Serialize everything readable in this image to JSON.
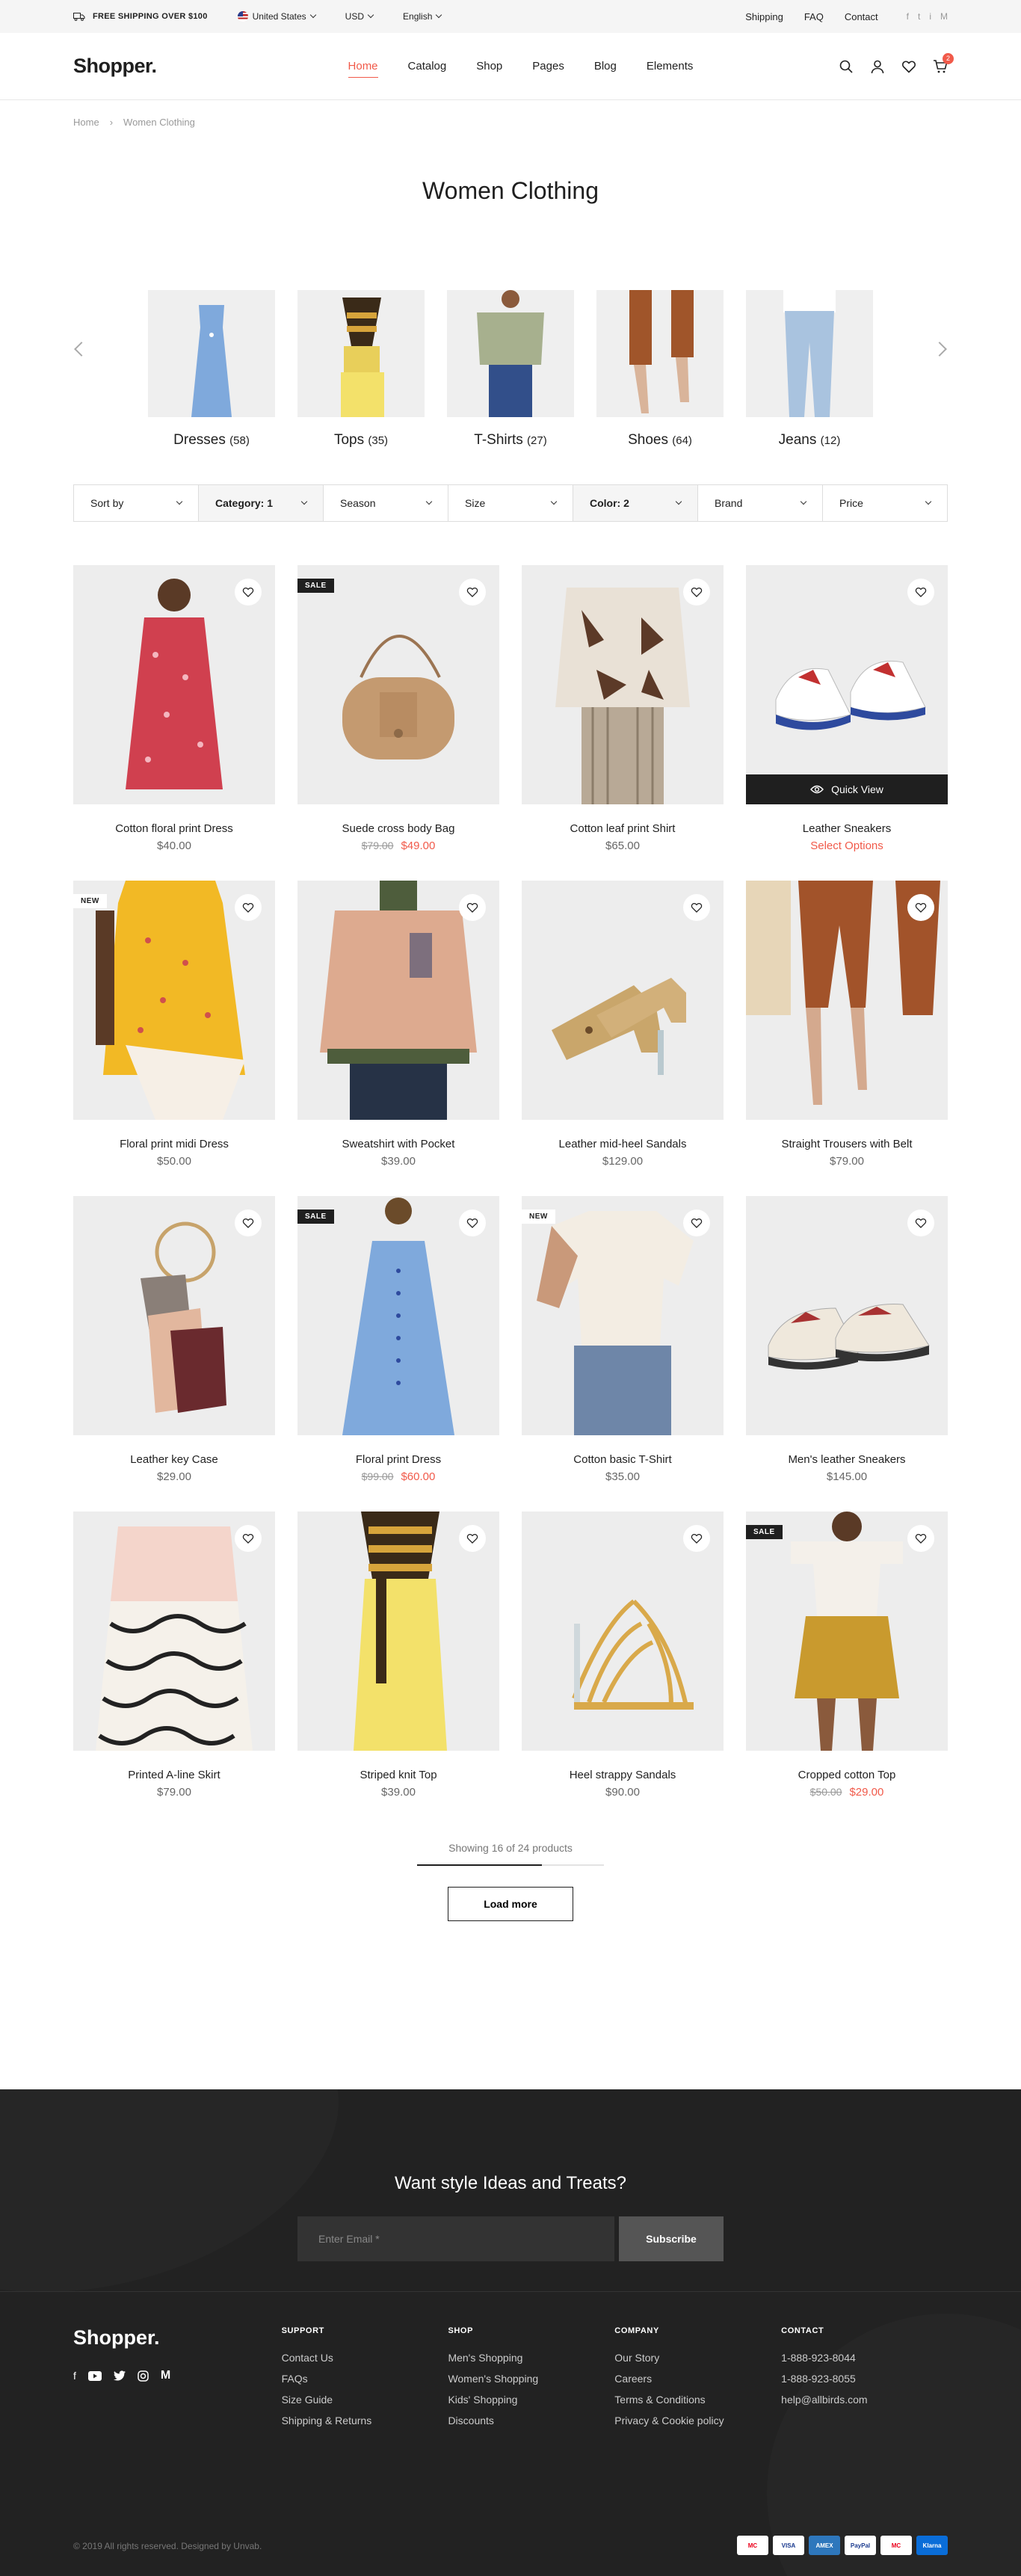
{
  "topbar": {
    "shipping": "FREE SHIPPING OVER $100",
    "country": "United States",
    "currency": "USD",
    "language": "English",
    "links": [
      "Shipping",
      "FAQ",
      "Contact"
    ],
    "social": [
      "f",
      "t",
      "i",
      "M"
    ]
  },
  "header": {
    "logo": "Shopper.",
    "nav": [
      "Home",
      "Catalog",
      "Shop",
      "Pages",
      "Blog",
      "Elements"
    ],
    "active_nav": "Home",
    "cart_count": "2"
  },
  "breadcrumb": [
    "Home",
    "Women Clothing"
  ],
  "page_title": "Women Clothing",
  "categories": [
    {
      "name": "Dresses",
      "count": "(58)"
    },
    {
      "name": "Tops",
      "count": "(35)"
    },
    {
      "name": "T-Shirts",
      "count": "(27)"
    },
    {
      "name": "Shoes",
      "count": "(64)"
    },
    {
      "name": "Jeans",
      "count": "(12)"
    }
  ],
  "filters": [
    {
      "label": "Sort by",
      "active": false
    },
    {
      "label": "Category: 1",
      "active": true
    },
    {
      "label": "Season",
      "active": false
    },
    {
      "label": "Size",
      "active": false
    },
    {
      "label": "Color: 2",
      "active": true
    },
    {
      "label": "Brand",
      "active": false
    },
    {
      "label": "Price",
      "active": false
    }
  ],
  "products": [
    {
      "name": "Cotton floral print Dress",
      "price": "$40.00",
      "old": "",
      "tag": ""
    },
    {
      "name": "Suede cross body Bag",
      "price": "$49.00",
      "old": "$79.00",
      "tag": "SALE"
    },
    {
      "name": "Cotton leaf print Shirt",
      "price": "$65.00",
      "old": "",
      "tag": ""
    },
    {
      "name": "Leather Sneakers",
      "price": "Select Options",
      "old": "",
      "tag": "",
      "quick_view": "Quick View"
    },
    {
      "name": "Floral print midi Dress",
      "price": "$50.00",
      "old": "",
      "tag": "NEW"
    },
    {
      "name": "Sweatshirt with Pocket",
      "price": "$39.00",
      "old": "",
      "tag": ""
    },
    {
      "name": "Leather mid-heel Sandals",
      "price": "$129.00",
      "old": "",
      "tag": ""
    },
    {
      "name": "Straight Trousers with Belt",
      "price": "$79.00",
      "old": "",
      "tag": ""
    },
    {
      "name": "Leather key Case",
      "price": "$29.00",
      "old": "",
      "tag": ""
    },
    {
      "name": "Floral print Dress",
      "price": "$60.00",
      "old": "$99.00",
      "tag": "SALE"
    },
    {
      "name": "Cotton basic T-Shirt",
      "price": "$35.00",
      "old": "",
      "tag": "NEW"
    },
    {
      "name": "Men's leather Sneakers",
      "price": "$145.00",
      "old": "",
      "tag": ""
    },
    {
      "name": "Printed A-line Skirt",
      "price": "$79.00",
      "old": "",
      "tag": ""
    },
    {
      "name": "Striped knit Top",
      "price": "$39.00",
      "old": "",
      "tag": ""
    },
    {
      "name": "Heel strappy Sandals",
      "price": "$90.00",
      "old": "",
      "tag": ""
    },
    {
      "name": "Cropped cotton Top",
      "price": "$29.00",
      "old": "$50.00",
      "tag": "SALE"
    }
  ],
  "pagination": {
    "showing": "Showing 16 of 24 products",
    "progress": 0.6667,
    "load_more": "Load more"
  },
  "footer": {
    "newsletter_title": "Want style Ideas and Treats?",
    "email_placeholder": "Enter Email *",
    "subscribe": "Subscribe",
    "logo": "Shopper.",
    "columns": [
      {
        "title": "SUPPORT",
        "items": [
          "Contact Us",
          "FAQs",
          "Size Guide",
          "Shipping & Returns"
        ]
      },
      {
        "title": "SHOP",
        "items": [
          "Men's Shopping",
          "Women's Shopping",
          "Kids' Shopping",
          "Discounts"
        ]
      },
      {
        "title": "COMPANY",
        "items": [
          "Our Story",
          "Careers",
          "Terms & Conditions",
          "Privacy & Cookie policy"
        ]
      },
      {
        "title": "CONTACT",
        "items": [
          "1-888-923-8044",
          "1-888-923-8055",
          "help@allbirds.com"
        ]
      }
    ],
    "copyright": "© 2019 All rights reserved. Designed by Unvab.",
    "payments": [
      "MC",
      "VISA",
      "AMEX",
      "PayPal",
      "MC",
      "Klarna"
    ]
  },
  "colors": {
    "accent": "#f15a4a",
    "dark": "#1f1f1f",
    "footer": "#222222"
  }
}
